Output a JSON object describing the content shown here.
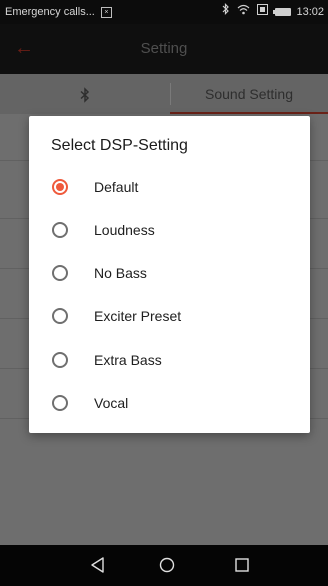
{
  "status_bar": {
    "carrier_text": "Emergency calls...",
    "time": "13:02",
    "icons": [
      "sim-icon",
      "bluetooth-icon",
      "wifi-icon",
      "nfc-icon",
      "battery-icon"
    ]
  },
  "app_bar": {
    "title": "Setting",
    "back_icon": "back-arrow-icon"
  },
  "tabs": [
    {
      "label": "",
      "icon": "bluetooth-icon"
    },
    {
      "label": "Sound Setting",
      "selected": true
    }
  ],
  "dialog": {
    "title": "Select DSP-Setting",
    "options": [
      {
        "label": "Default",
        "selected": true
      },
      {
        "label": "Loudness",
        "selected": false
      },
      {
        "label": "No Bass",
        "selected": false
      },
      {
        "label": "Exciter Preset",
        "selected": false
      },
      {
        "label": "Extra Bass",
        "selected": false
      },
      {
        "label": "Vocal",
        "selected": false
      }
    ]
  },
  "colors": {
    "accent": "#ef5a3c"
  },
  "nav_bar": {
    "icons": [
      "nav-back-icon",
      "nav-home-icon",
      "nav-recent-icon"
    ]
  }
}
